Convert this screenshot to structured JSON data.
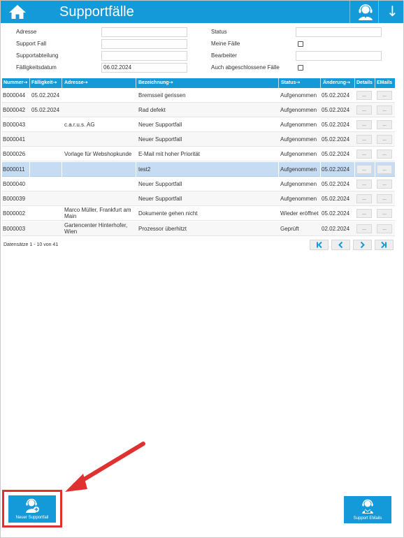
{
  "header": {
    "title": "Supportfälle",
    "home_icon": "home-icon",
    "support_icon": "headset-agent-icon",
    "arrow_icon": "arrow-down-icon",
    "arrow_glyph": "↓",
    "bar_color": "#149ad8"
  },
  "filter": {
    "adresse_label": "Adresse",
    "adresse_value": "",
    "supportfall_label": "Support Fall",
    "supportfall_value": "",
    "abteilung_label": "Supportabteilung",
    "abteilung_value": "",
    "faelligkeit_label": "Fälligkeitsdatum",
    "faelligkeit_value": "06.02.2024",
    "status_label": "Status",
    "status_value": "",
    "meine_label": "Meine Fälle",
    "bearbeiter_label": "Bearbeiter",
    "bearbeiter_value": "",
    "abgeschlossen_label": "Auch abgeschlossene Fälle"
  },
  "table": {
    "columns": [
      {
        "label": "Nummer",
        "sort_icon": "⇢"
      },
      {
        "label": "Fälligkeit",
        "sort_icon": "⇢"
      },
      {
        "label": "Adresse",
        "sort_icon": "⇢"
      },
      {
        "label": "Bezeichnung",
        "sort_icon": "⇢"
      },
      {
        "label": "Status",
        "sort_icon": "⇢"
      },
      {
        "label": "Änderung",
        "sort_icon": "⇢"
      },
      {
        "label": "Details",
        "sort_icon": ""
      },
      {
        "label": "EMails",
        "sort_icon": ""
      }
    ],
    "rows": [
      {
        "nummer": "B000044",
        "faelligkeit": "05.02.2024",
        "adresse": "",
        "bezeichnung": "Bremsseil gerissen",
        "status": "Aufgenommen",
        "aenderung": "05.02.2024",
        "details": "...",
        "emails": "..."
      },
      {
        "nummer": "B000042",
        "faelligkeit": "05.02.2024",
        "adresse": "",
        "bezeichnung": "Rad defekt",
        "status": "Aufgenommen",
        "aenderung": "05.02.2024",
        "details": "...",
        "emails": "..."
      },
      {
        "nummer": "B000043",
        "faelligkeit": "",
        "adresse": "c.a.r.u.s. AG",
        "bezeichnung": "Neuer Supportfall",
        "status": "Aufgenommen",
        "aenderung": "05.02.2024",
        "details": "...",
        "emails": "..."
      },
      {
        "nummer": "B000041",
        "faelligkeit": "",
        "adresse": "",
        "bezeichnung": "Neuer Supportfall",
        "status": "Aufgenommen",
        "aenderung": "05.02.2024",
        "details": "...",
        "emails": "..."
      },
      {
        "nummer": "B000026",
        "faelligkeit": "",
        "adresse": "Vorlage für Webshopkunde",
        "bezeichnung": "E-Mail mit hoher Priorität",
        "status": "Aufgenommen",
        "aenderung": "05.02.2024",
        "details": "...",
        "emails": "..."
      },
      {
        "nummer": "B000011",
        "faelligkeit": "",
        "adresse": "",
        "bezeichnung": "test2",
        "status": "Aufgenommen",
        "aenderung": "05.02.2024",
        "details": "...",
        "emails": "..."
      },
      {
        "nummer": "B000040",
        "faelligkeit": "",
        "adresse": "",
        "bezeichnung": "Neuer Supportfall",
        "status": "Aufgenommen",
        "aenderung": "05.02.2024",
        "details": "...",
        "emails": "..."
      },
      {
        "nummer": "B000039",
        "faelligkeit": "",
        "adresse": "",
        "bezeichnung": "Neuer Supportfall",
        "status": "Aufgenommen",
        "aenderung": "05.02.2024",
        "details": "...",
        "emails": "..."
      },
      {
        "nummer": "B000002",
        "faelligkeit": "",
        "adresse": "Marco Müller, Frankfurt am Main",
        "bezeichnung": "Dokumente gehen nicht",
        "status": "Wieder eröffnet",
        "aenderung": "05.02.2024",
        "details": "...",
        "emails": "..."
      },
      {
        "nummer": "B000003",
        "faelligkeit": "",
        "adresse": "Gartencenter Hinterhofer, Wien",
        "bezeichnung": "Prozessor überhitzt",
        "status": "Geprüft",
        "aenderung": "02.02.2024",
        "details": "...",
        "emails": "..."
      }
    ],
    "selected_row": "B000011",
    "selected_color": "#c5dcf3"
  },
  "pager": {
    "records_text": "Datensätze 1 - 10 von 41",
    "first_icon": "first-page-icon",
    "prev_icon": "previous-page-icon",
    "next_icon": "next-page-icon",
    "last_icon": "last-page-icon"
  },
  "footer": {
    "new_case_label": "Neuer Supportfall",
    "new_case_icon": "headset-add-icon",
    "support_emails_label": "Support EMails",
    "support_emails_icon": "headset-mail-icon"
  },
  "annotation": {
    "color": "#e03131"
  }
}
